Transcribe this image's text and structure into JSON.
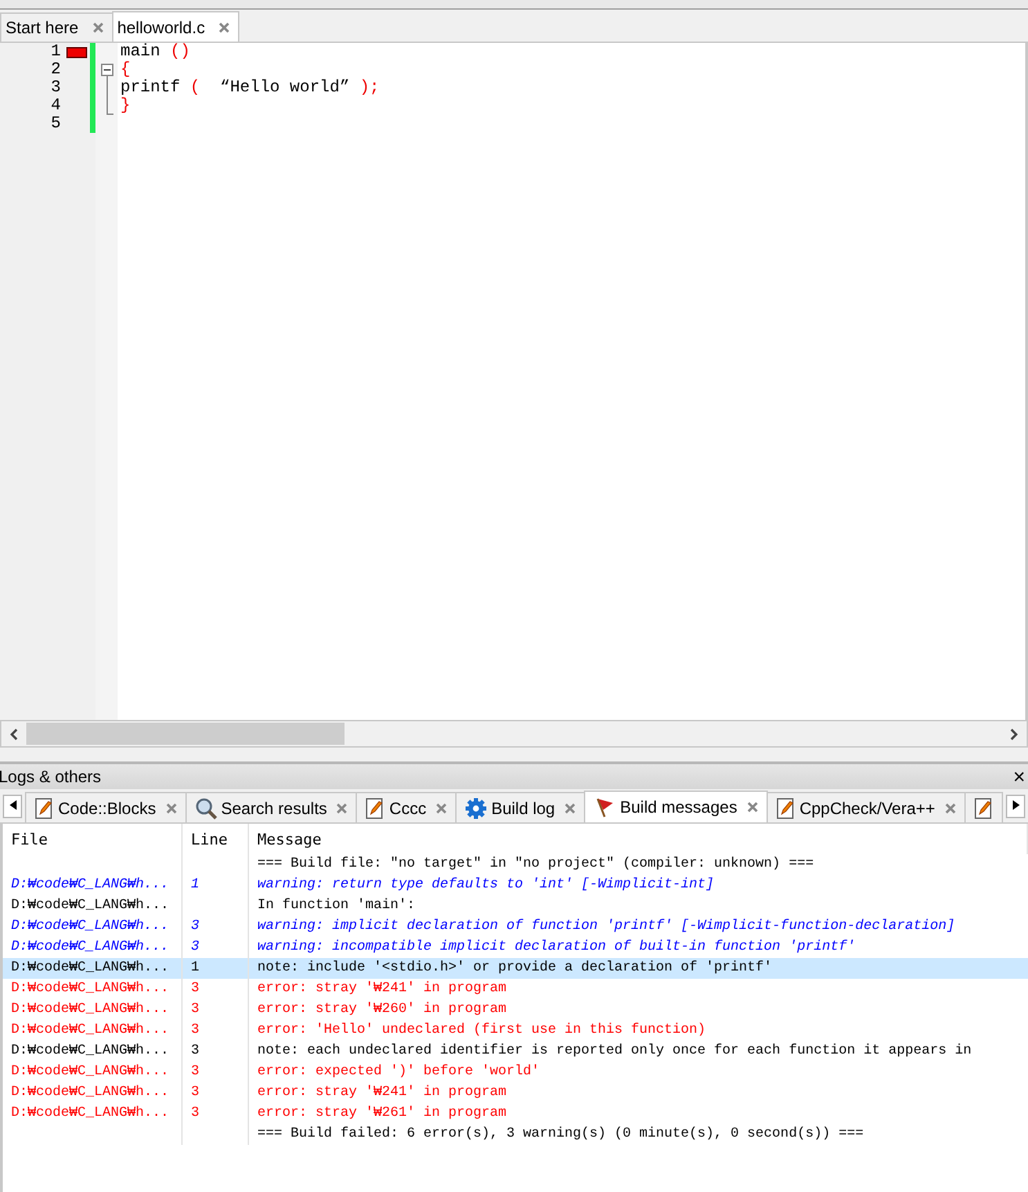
{
  "editor_tabs": [
    {
      "label": "Start here",
      "selected": false
    },
    {
      "label": "helloworld.c",
      "selected": true
    }
  ],
  "editor": {
    "lines": [
      {
        "number": "1",
        "error_marker": true,
        "changed": true,
        "tokens": [
          {
            "text": "main ",
            "kind": "plain"
          },
          {
            "text": "()",
            "kind": "operator"
          }
        ]
      },
      {
        "number": "2",
        "error_marker": false,
        "changed": true,
        "tokens": [
          {
            "text": "{",
            "kind": "operator"
          }
        ]
      },
      {
        "number": "3",
        "error_marker": false,
        "changed": true,
        "tokens": [
          {
            "text": "printf ",
            "kind": "plain"
          },
          {
            "text": "(",
            "kind": "operator"
          },
          {
            "text": "  “Hello world” ",
            "kind": "plain"
          },
          {
            "text": ");",
            "kind": "operator"
          }
        ]
      },
      {
        "number": "4",
        "error_marker": false,
        "changed": true,
        "tokens": [
          {
            "text": "}",
            "kind": "operator"
          }
        ]
      },
      {
        "number": "5",
        "error_marker": false,
        "changed": true
      }
    ]
  },
  "logs_panel": {
    "title": "Logs & others",
    "close": "×",
    "tabs": [
      {
        "label": "Code::Blocks",
        "kind": "pencil",
        "selected": false
      },
      {
        "label": "Search results",
        "kind": "search",
        "selected": false
      },
      {
        "label": "Cccc",
        "kind": "pencil",
        "selected": false
      },
      {
        "label": "Build log",
        "kind": "gear",
        "selected": false
      },
      {
        "label": "Build messages",
        "kind": "flag",
        "selected": true
      },
      {
        "label": "CppCheck/Vera++",
        "kind": "pencil",
        "selected": false
      },
      {
        "kind": "pencil",
        "selected": false
      }
    ],
    "columns": [
      "File",
      "Line",
      "Message"
    ],
    "rows": [
      {
        "kind": "info",
        "message": "=== Build file: \"no target\" in \"no project\" (compiler: unknown) ===",
        "selected": false
      },
      {
        "kind": "warning",
        "file": "D:₩code₩C_LANG₩h...",
        "line": "1",
        "message": "warning: return type defaults to 'int' [-Wimplicit-int]",
        "selected": false
      },
      {
        "kind": "note",
        "file": "D:₩code₩C_LANG₩h...",
        "message": "In function 'main':",
        "selected": false
      },
      {
        "kind": "warning",
        "file": "D:₩code₩C_LANG₩h...",
        "line": "3",
        "message": "warning: implicit declaration of function 'printf' [-Wimplicit-function-declaration]",
        "selected": false
      },
      {
        "kind": "warning",
        "file": "D:₩code₩C_LANG₩h...",
        "line": "3",
        "message": "warning: incompatible implicit declaration of built-in function 'printf'",
        "selected": false
      },
      {
        "kind": "note",
        "file": "D:₩code₩C_LANG₩h...",
        "line": "1",
        "message": "note: include '<stdio.h>' or provide a declaration of 'printf'",
        "selected": true
      },
      {
        "kind": "error",
        "file": "D:₩code₩C_LANG₩h...",
        "line": "3",
        "message": "error: stray '₩241' in program",
        "selected": false
      },
      {
        "kind": "error",
        "file": "D:₩code₩C_LANG₩h...",
        "line": "3",
        "message": "error: stray '₩260' in program",
        "selected": false
      },
      {
        "kind": "error",
        "file": "D:₩code₩C_LANG₩h...",
        "line": "3",
        "message": "error: 'Hello' undeclared (first use in this function)",
        "selected": false
      },
      {
        "kind": "note",
        "file": "D:₩code₩C_LANG₩h...",
        "line": "3",
        "message": "note: each undeclared identifier is reported only once for each function it appears in",
        "selected": false
      },
      {
        "kind": "error",
        "file": "D:₩code₩C_LANG₩h...",
        "line": "3",
        "message": "error: expected ')' before 'world'",
        "selected": false
      },
      {
        "kind": "error",
        "file": "D:₩code₩C_LANG₩h...",
        "line": "3",
        "message": "error: stray '₩241' in program",
        "selected": false
      },
      {
        "kind": "error",
        "file": "D:₩code₩C_LANG₩h...",
        "line": "3",
        "message": "error: stray '₩261' in program",
        "selected": false
      },
      {
        "kind": "info",
        "message": "=== Build failed: 6 error(s), 3 warning(s) (0 minute(s), 0 second(s)) ===",
        "selected": false
      }
    ]
  }
}
